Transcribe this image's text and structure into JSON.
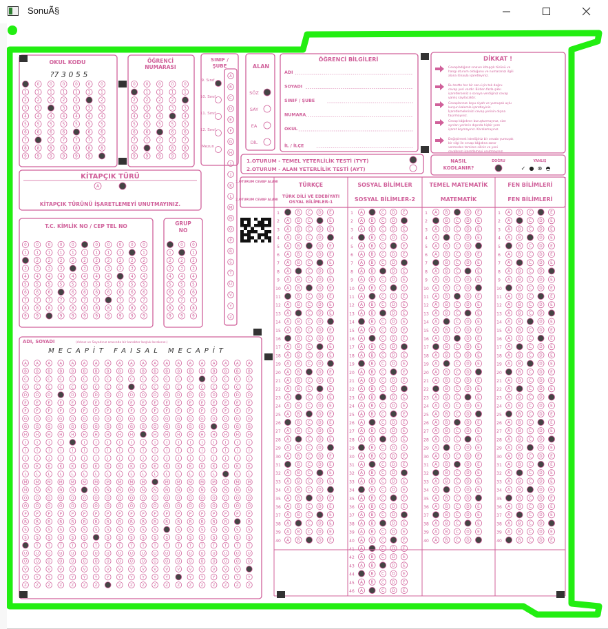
{
  "window": {
    "title": "SonuÃ§",
    "buttons": {
      "minimize": "minimize-icon",
      "maximize": "maximize-icon",
      "close": "close-icon"
    }
  },
  "colors": {
    "form_ink": "#d0609a",
    "detection_outline": "#22ee11",
    "bubble_fill": "#444444",
    "marker": "#333333"
  },
  "form": {
    "okul_kodu": {
      "title": "OKUL KODU",
      "handwritten": "?7 3 0 5 5"
    },
    "ogrenci_numarasi": {
      "title_line1": "ÖĞRENCİ",
      "title_line2": "NUMARASI"
    },
    "sinif_sube": {
      "title_line1": "SINIF /",
      "title_line2": "ŞUBE",
      "items": [
        "9. Sınıf",
        "10. Sınıf",
        "11. Sınıf",
        "12. Sınıf",
        "Mezun"
      ]
    },
    "alan": {
      "title": "ALAN",
      "items": [
        "SÖZ",
        "SAY",
        "EA",
        "DİL"
      ]
    },
    "ogrenci_bilgileri": {
      "title": "ÖĞRENCİ BİLGİLERİ",
      "fields": [
        "ADI",
        "SOYADI",
        "SINIF / ŞUBE",
        "NUMARA",
        "OKUL",
        "İL / İLÇE"
      ]
    },
    "dikkat": {
      "title": "DİKKAT !",
      "items": [
        "Cevapladığınız sınavın kitapçık türünü ve hangi oturum olduğunu ve numaranızı ilgili alana itinayla işaretleyiniz.",
        "Bu testte her bir soru için tek doğru cevap yeri vardır. Birden fazla şıkkı işaretlerseniz o soruya verdiğiniz cevap yanlış sayılacaktır.",
        "Cevaplarınızı koyu siyah ve yumuşak uçlu kurşun kalemle işaretleyiniz. İşaretlemelerinizi cevap yerinin dışına taşırmayınız.",
        "Cevap kâğıdının buruşturmayınız, size ayrılan yerlerin dışında hiçbir yere işaret koymayınız. Karalamayınız.",
        "Değiştirmek istediğiniz bir cevabı yumuşak bir silgi ile cevap kâğıdına zarar vermeden temizce siliniz ve yeni cevabınızı işaretlemeyi unutmayınız."
      ]
    },
    "kitapcik": {
      "title": "KİTAPÇIK TÜRÜ",
      "options": [
        "A",
        "B"
      ],
      "warning": "KİTAPÇIK TÜRÜNÜ İŞARETLEMEYİ UNUTMAYINIZ."
    },
    "oturum": {
      "line1": "1.OTURUM - TEMEL YETERLİLİK TESTİ (TYT)",
      "line2": "2.OTURUM - ALAN YETERLİLİK TESTİ (AYT)"
    },
    "nasil": {
      "label_line1": "NASIL",
      "label_line2": "KODLANIR?",
      "dogru": "DOĞRU",
      "yanlis": "YANLIŞ"
    },
    "tc": {
      "title": "T.C. KİMLİK NO / CEP TEL NO"
    },
    "grup": {
      "title_line1": "GRUP",
      "title_line2": "NO"
    },
    "adi_soyadi": {
      "title": "ADI, SOYADI",
      "note": "(Adınız ve Soyadınız arasında bir karakter boşluk bırakınız.)",
      "handwritten": "MECAPİT FAISAL MECAPİT"
    },
    "answers": {
      "row_labels": {
        "oturum1": "1.OTURUM CEVAP ALANI",
        "oturum2": "2.OTURUM CEVAP ALANI"
      },
      "columns": [
        {
          "h1": "TÜRKÇE",
          "h2": "TÜRK DİLİ VE EDEBİYATI SOSYAL BİLİMLER-1",
          "count": 40
        },
        {
          "h1": "SOSYAL BİLİMLER",
          "h2": "SOSYAL BİLİMLER-2",
          "count": 46
        },
        {
          "h1": "TEMEL MATEMATİK",
          "h2": "MATEMATİK",
          "count": 40
        },
        {
          "h1": "FEN BİLİMLERİ",
          "h2": "FEN BİLİMLERİ",
          "count": 40
        }
      ],
      "options": [
        "A",
        "B",
        "C",
        "D",
        "E"
      ]
    }
  }
}
